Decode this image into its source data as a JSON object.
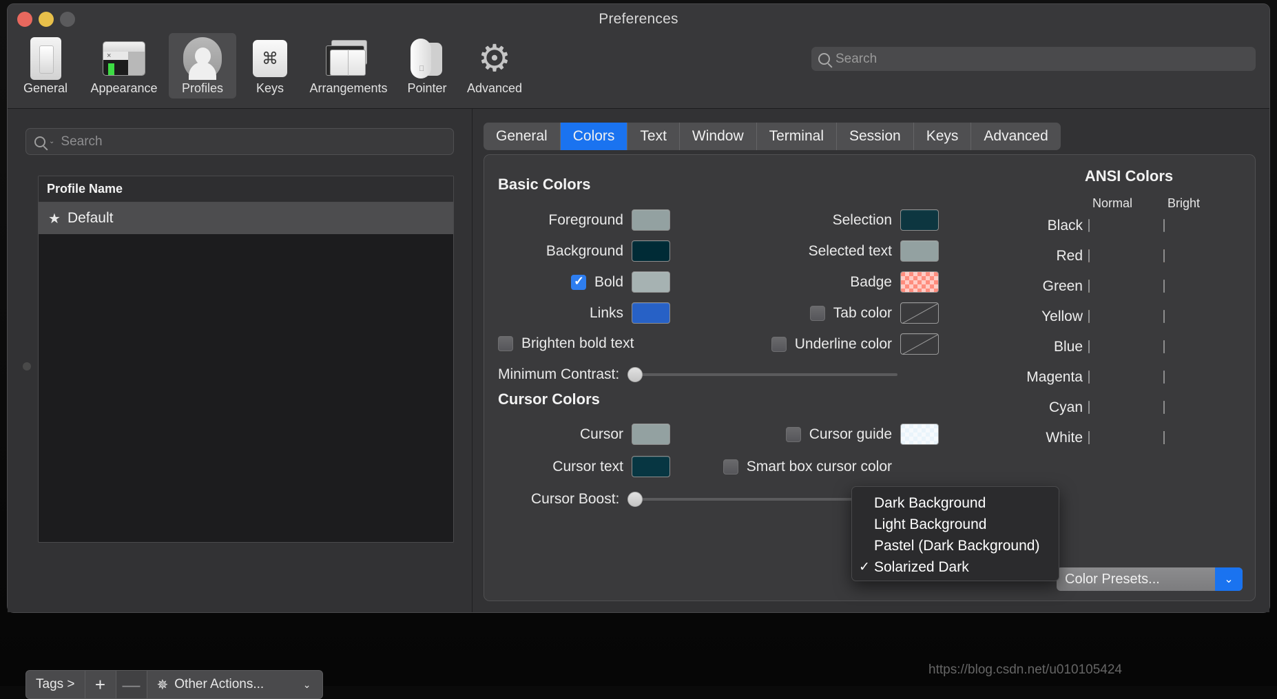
{
  "window": {
    "title": "Preferences"
  },
  "toolbar": {
    "items": [
      {
        "label": "General",
        "icon": "general-icon"
      },
      {
        "label": "Appearance",
        "icon": "appearance-icon"
      },
      {
        "label": "Profiles",
        "icon": "profiles-icon"
      },
      {
        "label": "Keys",
        "icon": "keys-icon"
      },
      {
        "label": "Arrangements",
        "icon": "arrangements-icon"
      },
      {
        "label": "Pointer",
        "icon": "pointer-icon"
      },
      {
        "label": "Advanced",
        "icon": "advanced-gear-icon"
      }
    ],
    "selected": "Profiles",
    "search_placeholder": "Search"
  },
  "profiles": {
    "search_placeholder": "Search",
    "column_header": "Profile Name",
    "rows": [
      {
        "name": "Default",
        "is_default": true
      }
    ],
    "actions": {
      "tags_label": "Tags >",
      "add_label": "+",
      "remove_label": "—",
      "other_label": "Other Actions...",
      "chevron": "⌄"
    }
  },
  "tabs": {
    "items": [
      "General",
      "Colors",
      "Text",
      "Window",
      "Terminal",
      "Session",
      "Keys",
      "Advanced"
    ],
    "active": "Colors"
  },
  "basic_colors": {
    "title": "Basic Colors",
    "left": [
      {
        "label": "Foreground",
        "color": "#93a1a1",
        "checkbox": null
      },
      {
        "label": "Background",
        "color": "#002b36",
        "checkbox": null
      },
      {
        "label": "Bold",
        "color": "#a6b2b2",
        "checkbox": true
      },
      {
        "label": "Links",
        "color": "#2761c6",
        "checkbox": null
      }
    ],
    "brighten_bold": {
      "label": "Brighten bold text",
      "checked": false
    },
    "right": [
      {
        "label": "Selection",
        "color": "#0d3640",
        "checkbox": null,
        "style": "solid"
      },
      {
        "label": "Selected text",
        "color": "#93a1a1",
        "checkbox": null,
        "style": "solid"
      },
      {
        "label": "Badge",
        "color": "#ff8d7e",
        "checkbox": null,
        "style": "checker"
      },
      {
        "label": "Tab color",
        "color": null,
        "checkbox": false,
        "style": "none"
      },
      {
        "label": "Underline color",
        "color": null,
        "checkbox": false,
        "style": "none"
      }
    ],
    "min_contrast": {
      "label": "Minimum Contrast:",
      "value": 0
    }
  },
  "cursor_colors": {
    "title": "Cursor Colors",
    "left": [
      {
        "label": "Cursor",
        "color": "#93a1a1"
      },
      {
        "label": "Cursor text",
        "color": "#073642"
      }
    ],
    "right": [
      {
        "label": "Cursor guide",
        "checked": false,
        "style": "checker",
        "color": "#eaf4fb"
      },
      {
        "label": "Smart box cursor color",
        "checked": false,
        "style": "nobox",
        "color": null
      }
    ],
    "cursor_boost": {
      "label": "Cursor Boost:",
      "value": 0
    }
  },
  "ansi_colors": {
    "title": "ANSI Colors",
    "col_normal": "Normal",
    "col_bright": "Bright",
    "rows": [
      {
        "name": "Black",
        "normal": "#16424f",
        "bright": "#042f3b"
      },
      {
        "name": "Red",
        "normal": "#dc4a3f",
        "bright": "#d05a26"
      },
      {
        "name": "Green",
        "normal": "#9aa825",
        "bright": "#6b7e87"
      },
      {
        "name": "Yellow",
        "normal": "#c5a024",
        "bright": "#7e909c"
      },
      {
        "name": "Blue",
        "normal": "#3d8fd1",
        "bright": "#8c9b9b"
      },
      {
        "name": "Magenta",
        "normal": "#cd4185",
        "bright": "#6c6fc6"
      },
      {
        "name": "Cyan",
        "normal": "#46a098",
        "bright": "#99a6a6"
      },
      {
        "name": "White",
        "normal": "#eee8d5",
        "bright": "#fdf6e3"
      }
    ]
  },
  "presets": {
    "button_label": "Color Presets...",
    "menu": [
      {
        "label": "Dark Background",
        "checked": false
      },
      {
        "label": "Light Background",
        "checked": false
      },
      {
        "label": "Pastel (Dark Background)",
        "checked": false
      },
      {
        "label": "Solarized Dark",
        "checked": true
      }
    ]
  },
  "watermark": "https://blog.csdn.net/u010105424"
}
